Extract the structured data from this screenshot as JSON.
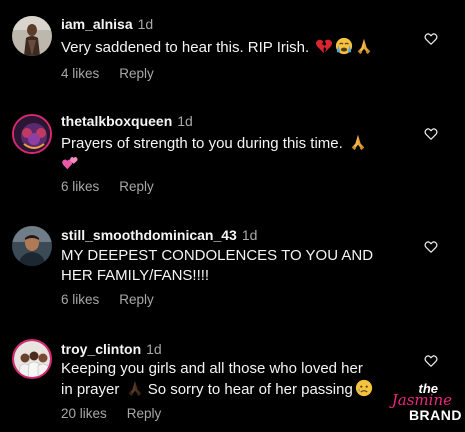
{
  "comments": [
    {
      "username": "iam_alnisa",
      "time": "1d",
      "text": "Very saddened to hear this. RIP Irish.",
      "emojis": [
        "broken-heart-emoji",
        "crying-face-emoji",
        "folded-hands-emoji"
      ],
      "likes": "4 likes",
      "reply": "Reply"
    },
    {
      "username": "thetalkboxqueen",
      "time": "1d",
      "text": "Prayers of strength to you during this time.",
      "emojis": [
        "folded-hands-emoji",
        "two-hearts-emoji"
      ],
      "likes": "6 likes",
      "reply": "Reply"
    },
    {
      "username": "still_smoothdominican_43",
      "time": "1d",
      "text_line1": "MY DEEPEST CONDOLENCES TO YOU AND",
      "text_line2": "HER FAMILY/FANS!!!!",
      "likes": "6 likes",
      "reply": "Reply"
    },
    {
      "username": "troy_clinton",
      "time": "1d",
      "text_line1": "Keeping you girls and all those who loved her",
      "text_line2a": "in prayer",
      "text_line2b": "So sorry to hear of her passing",
      "emojis": [
        "folded-hands-dark-emoji",
        "sad-face-emoji"
      ],
      "likes": "20 likes",
      "reply": "Reply"
    }
  ],
  "watermark": {
    "the": "the",
    "jasmine": "Jasmine",
    "brand": "BRAND"
  },
  "colors": {
    "background": "#000000",
    "text": "#f5f5f5",
    "muted": "#a8a8a8",
    "story_ring": "#d62976",
    "brand_pink": "#ec2a7d"
  }
}
